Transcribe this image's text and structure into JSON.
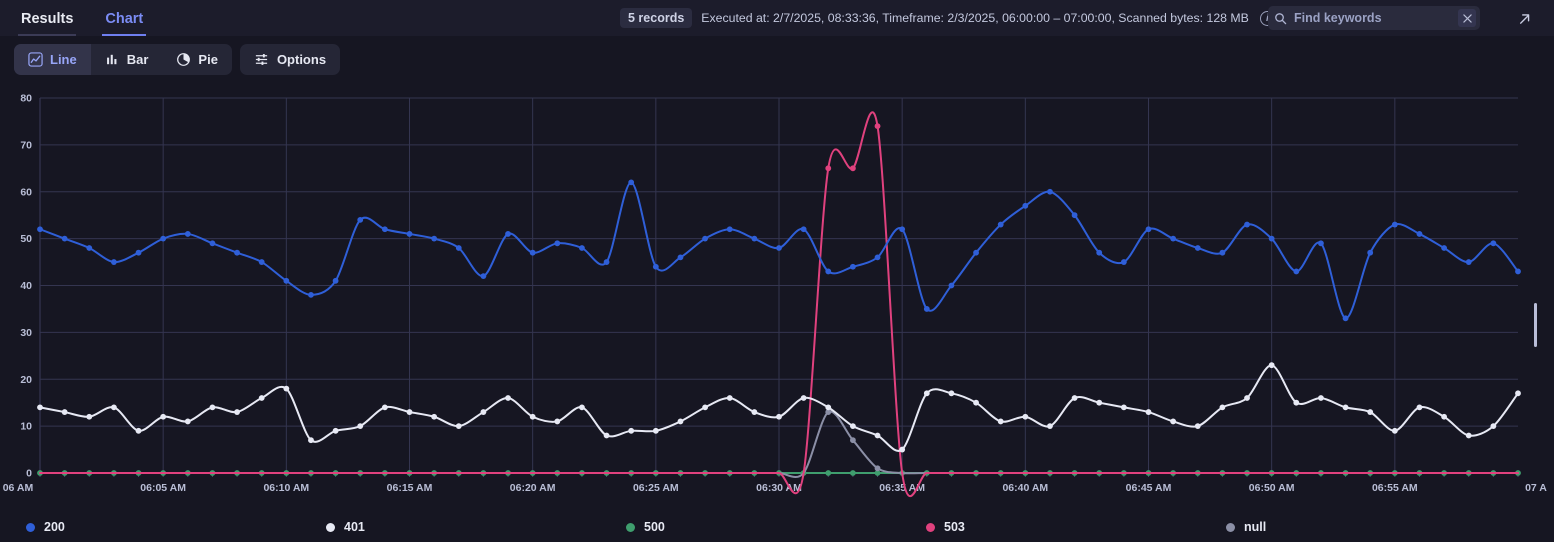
{
  "header": {
    "tabs": [
      {
        "label": "Results",
        "active": false
      },
      {
        "label": "Chart",
        "active": true
      }
    ],
    "records_badge": "5 records",
    "meta_text": "Executed at: 2/7/2025, 08:33:36, Timeframe: 2/3/2025, 06:00:00 – 07:00:00, Scanned bytes: 128 MB",
    "info_icon": "info-icon",
    "search": {
      "placeholder": "Find keywords",
      "value": "",
      "icon": "search-icon",
      "clear_icon": "close-icon"
    },
    "expand_icon": "expand-arrow-icon"
  },
  "toolbar": {
    "types": [
      {
        "label": "Line",
        "icon": "line-chart-icon",
        "active": true
      },
      {
        "label": "Bar",
        "icon": "bar-chart-icon",
        "active": false
      },
      {
        "label": "Pie",
        "icon": "pie-chart-icon",
        "active": false
      }
    ],
    "options_label": "Options",
    "options_icon": "sliders-icon"
  },
  "colors": {
    "background": "#161622",
    "topbar": "#1c1c2b",
    "accent": "#6f7ff0",
    "grid": "#343550",
    "axis_text": "#b9bed6",
    "series_200": "#2f5fd8",
    "series_401": "#e7e9f4",
    "series_500": "#3f9e6e",
    "series_503": "#e0417e",
    "series_null": "#8b8fa6"
  },
  "chart_data": {
    "type": "line",
    "title": "",
    "xlabel": "",
    "ylabel": "",
    "ylim": [
      0,
      80
    ],
    "yticks": [
      0,
      10,
      20,
      30,
      40,
      50,
      60,
      70,
      80
    ],
    "grid": true,
    "legend_position": "bottom",
    "x_start_minute": 0,
    "x_end_minute": 60,
    "x_tick_labels": [
      "06 AM",
      "06:05 AM",
      "06:10 AM",
      "06:15 AM",
      "06:20 AM",
      "06:25 AM",
      "06:30 AM",
      "06:35 AM",
      "06:40 AM",
      "06:45 AM",
      "06:50 AM",
      "06:55 AM",
      "07 A"
    ],
    "x_tick_minutes": [
      0,
      5,
      10,
      15,
      20,
      25,
      30,
      35,
      40,
      45,
      50,
      55,
      60
    ],
    "highlighted_tick": "06:30 AM",
    "x": [
      0,
      1,
      2,
      3,
      4,
      5,
      6,
      7,
      8,
      9,
      10,
      11,
      12,
      13,
      14,
      15,
      16,
      17,
      18,
      19,
      20,
      21,
      22,
      23,
      24,
      25,
      26,
      27,
      28,
      29,
      30,
      31,
      32,
      33,
      34,
      35,
      36,
      37,
      38,
      39,
      40,
      41,
      42,
      43,
      44,
      45,
      46,
      47,
      48,
      49,
      50,
      51,
      52,
      53,
      54,
      55,
      56,
      57,
      58,
      59,
      60
    ],
    "series": [
      {
        "name": "200",
        "color": "#2f5fd8",
        "values": [
          52,
          50,
          48,
          45,
          47,
          50,
          51,
          49,
          47,
          45,
          41,
          38,
          41,
          54,
          52,
          51,
          50,
          48,
          42,
          51,
          47,
          49,
          48,
          45,
          62,
          44,
          46,
          50,
          52,
          50,
          48,
          52,
          43,
          44,
          46,
          52,
          35,
          40,
          47,
          53,
          57,
          60,
          55,
          47,
          45,
          52,
          50,
          48,
          47,
          53,
          50,
          43,
          49,
          33,
          47,
          53,
          51,
          48,
          45,
          49,
          43
        ]
      },
      {
        "name": "401",
        "color": "#e7e9f4",
        "values": [
          14,
          13,
          12,
          14,
          9,
          12,
          11,
          14,
          13,
          16,
          18,
          7,
          9,
          10,
          14,
          13,
          12,
          10,
          13,
          16,
          12,
          11,
          14,
          8,
          9,
          9,
          11,
          14,
          16,
          13,
          12,
          16,
          14,
          10,
          8,
          5,
          17,
          17,
          15,
          11,
          12,
          10,
          16,
          15,
          14,
          13,
          11,
          10,
          14,
          16,
          23,
          15,
          16,
          14,
          13,
          9,
          14,
          12,
          8,
          10,
          17
        ]
      },
      {
        "name": "500",
        "color": "#3f9e6e",
        "values": [
          0,
          0,
          0,
          0,
          0,
          0,
          0,
          0,
          0,
          0,
          0,
          0,
          0,
          0,
          0,
          0,
          0,
          0,
          0,
          0,
          0,
          0,
          0,
          0,
          0,
          0,
          0,
          0,
          0,
          0,
          0,
          0,
          0,
          0,
          0,
          0,
          0,
          0,
          0,
          0,
          0,
          0,
          0,
          0,
          0,
          0,
          0,
          0,
          0,
          0,
          0,
          0,
          0,
          0,
          0,
          0,
          0,
          0,
          0,
          0,
          0
        ]
      },
      {
        "name": "503",
        "color": "#e0417e",
        "values": [
          0,
          0,
          0,
          0,
          0,
          0,
          0,
          0,
          0,
          0,
          0,
          0,
          0,
          0,
          0,
          0,
          0,
          0,
          0,
          0,
          0,
          0,
          0,
          0,
          0,
          0,
          0,
          0,
          0,
          0,
          0,
          0,
          65,
          65,
          74,
          0,
          0,
          0,
          0,
          0,
          0,
          0,
          0,
          0,
          0,
          0,
          0,
          0,
          0,
          0,
          0,
          0,
          0,
          0,
          0,
          0,
          0,
          0,
          0,
          0,
          0
        ]
      },
      {
        "name": "null",
        "color": "#8b8fa6",
        "values": [
          0,
          0,
          0,
          0,
          0,
          0,
          0,
          0,
          0,
          0,
          0,
          0,
          0,
          0,
          0,
          0,
          0,
          0,
          0,
          0,
          0,
          0,
          0,
          0,
          0,
          0,
          0,
          0,
          0,
          0,
          0,
          0,
          13,
          7,
          1,
          0,
          0,
          0,
          0,
          0,
          0,
          0,
          0,
          0,
          0,
          0,
          0,
          0,
          0,
          0,
          0,
          0,
          0,
          0,
          0,
          0,
          0,
          0,
          0,
          0,
          0
        ]
      }
    ],
    "legend": [
      {
        "label": "200",
        "color": "#2f5fd8"
      },
      {
        "label": "401",
        "color": "#e7e9f4"
      },
      {
        "label": "500",
        "color": "#3f9e6e"
      },
      {
        "label": "503",
        "color": "#e0417e"
      },
      {
        "label": "null",
        "color": "#8b8fa6"
      }
    ]
  }
}
